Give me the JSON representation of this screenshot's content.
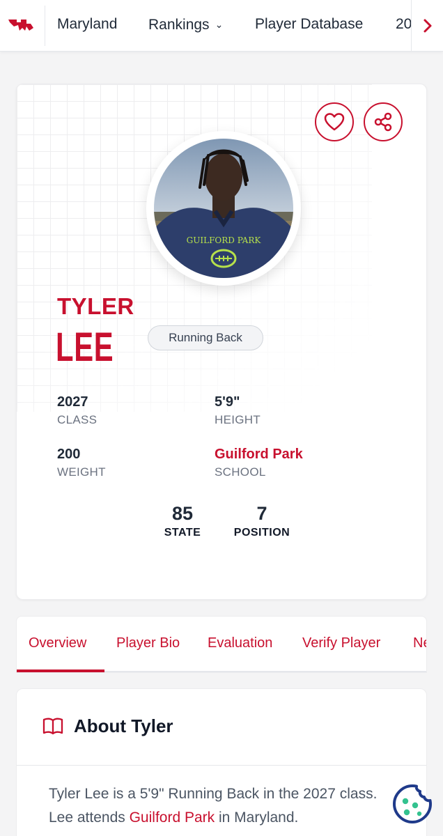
{
  "nav": {
    "items": [
      "Maryland",
      "Rankings",
      "Player Database",
      "20"
    ],
    "rankings_chevron": "chevron-down-icon",
    "next_icon": "chevron-right-icon"
  },
  "player": {
    "first_name": "TYLER",
    "last_name": "LEE",
    "position": "Running Back",
    "photo_jersey_text": "GUILFORD PARK",
    "stats": {
      "class_value": "2027",
      "class_label": "CLASS",
      "height_value": "5'9\"",
      "height_label": "HEIGHT",
      "weight_value": "200",
      "weight_label": "WEIGHT",
      "school_value": "Guilford Park",
      "school_label": "SCHOOL"
    },
    "rankings": {
      "state_value": "85",
      "state_label": "STATE",
      "position_value": "7",
      "position_label": "POSITION"
    }
  },
  "tabs": [
    "Overview",
    "Player Bio",
    "Evaluation",
    "Verify Player",
    "Ne"
  ],
  "active_tab": "Overview",
  "about": {
    "title": "About Tyler",
    "text_before": "Tyler Lee is a 5'9\" Running Back in the 2027 class. Lee attends ",
    "school_link": "Guilford Park",
    "text_after": " in Maryland."
  },
  "colors": {
    "accent": "#c8102e",
    "text": "#1f2937",
    "muted": "#6b7280",
    "cookie": "#1f3a8a",
    "cookie_dots": "#34c28f"
  }
}
